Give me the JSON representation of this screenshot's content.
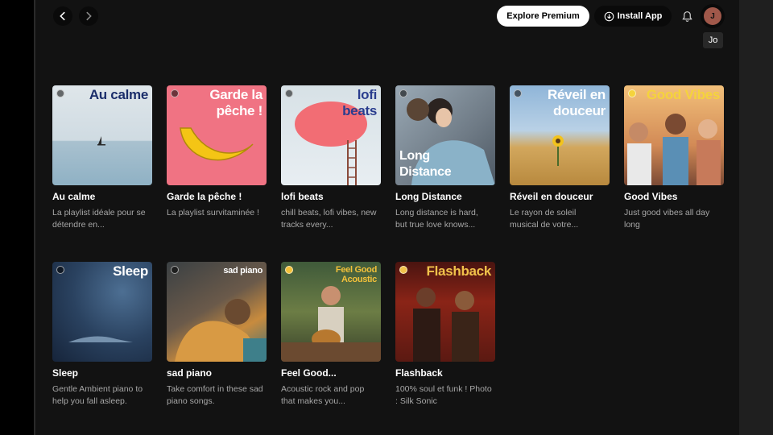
{
  "header": {
    "back_icon": "chevron-left-icon",
    "forward_icon": "chevron-right-icon",
    "explore_premium_label": "Explore Premium",
    "install_app_label": "Install App",
    "notifications_icon": "bell-icon",
    "avatar_initial": "J",
    "avatar_tooltip": "Jo"
  },
  "rows": [
    [
      {
        "cover_text": "Au calme",
        "title": "Au calme",
        "desc": "La playlist idéale pour se détendre en..."
      },
      {
        "cover_text": "Garde la pêche !",
        "title": "Garde la pêche !",
        "desc": "La playlist survitaminée !"
      },
      {
        "cover_text": "lofi beats",
        "title": "lofi beats",
        "desc": "chill beats, lofi vibes, new tracks every..."
      },
      {
        "cover_text": "Long Distance",
        "title": "Long Distance",
        "desc": "Long distance is hard, but true love knows..."
      },
      {
        "cover_text": "Réveil en douceur",
        "title": "Réveil en douceur",
        "desc": "Le rayon de soleil musical de votre..."
      },
      {
        "cover_text": "Good Vibes",
        "title": "Good Vibes",
        "desc": "Just good vibes all day long"
      }
    ],
    [
      {
        "cover_text": "Sleep",
        "title": "Sleep",
        "desc": "Gentle Ambient piano to help you fall asleep."
      },
      {
        "cover_text": "sad piano",
        "title": "sad piano",
        "desc": "Take comfort in these sad piano songs."
      },
      {
        "cover_text": "Feel Good Acoustic",
        "title": "Feel Good...",
        "desc": "Acoustic rock and pop that makes you..."
      },
      {
        "cover_text": "Flashback",
        "title": "Flashback",
        "desc": "100% soul et funk ! Photo : Silk Sonic"
      }
    ]
  ],
  "colors": {
    "background": "#121212",
    "sidebar": "#000000",
    "text_primary": "#ffffff",
    "text_secondary": "#a7a7a7"
  }
}
